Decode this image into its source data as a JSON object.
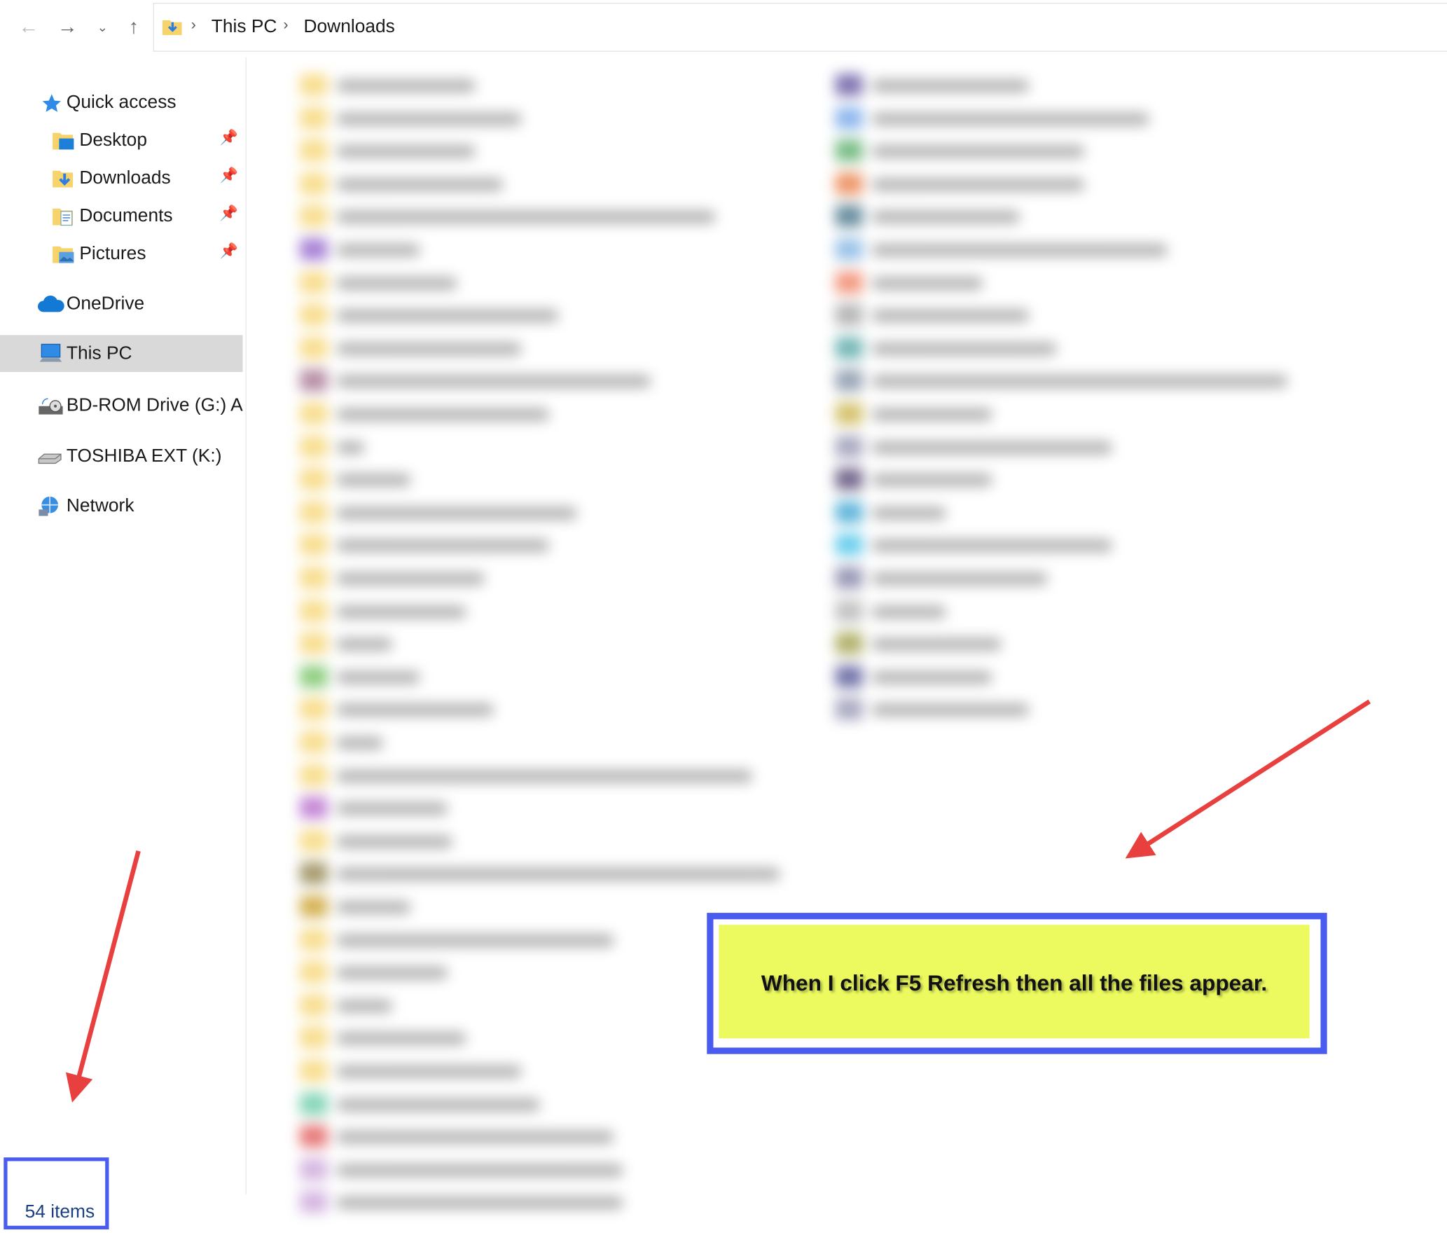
{
  "address_bar": {
    "back_icon": "arrow-left-icon",
    "forward_icon": "arrow-right-icon",
    "recent_icon": "chevron-down-icon",
    "up_icon": "arrow-up-icon",
    "breadcrumbs": [
      "This PC",
      "Downloads"
    ]
  },
  "sidebar": {
    "quick_access": "Quick access",
    "pinned": [
      {
        "label": "Desktop",
        "icon": "desktop-folder-icon"
      },
      {
        "label": "Downloads",
        "icon": "downloads-folder-icon"
      },
      {
        "label": "Documents",
        "icon": "documents-folder-icon"
      },
      {
        "label": "Pictures",
        "icon": "pictures-folder-icon"
      }
    ],
    "onedrive": "OneDrive",
    "this_pc": "This PC",
    "bd_rom": "BD-ROM Drive (G:) AS",
    "toshiba": "TOSHIBA EXT (K:)",
    "network": "Network"
  },
  "status_bar": {
    "item_count": "54 items"
  },
  "annotation": {
    "message": "When I click F5 Refresh then all the files appear."
  },
  "colors": {
    "highlight_border": "#4a5cf0",
    "callout_fill": "#ecfa5f",
    "arrow": "#e8403f",
    "selected_nav": "#d9d9d9",
    "folder": "#f6d36b"
  }
}
